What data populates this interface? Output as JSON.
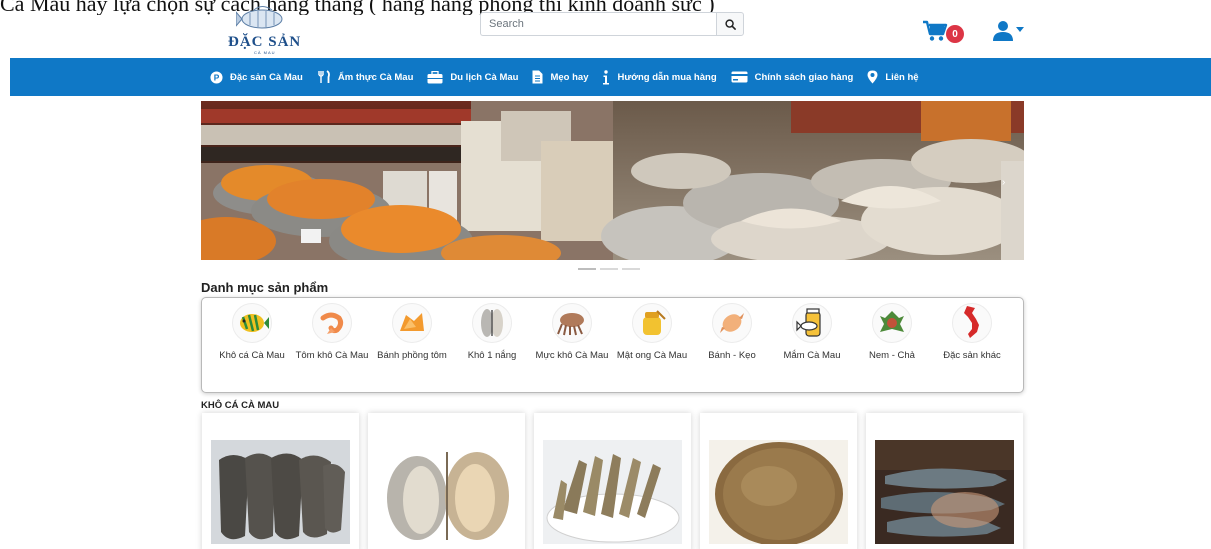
{
  "top_overflow_text": "Cà Mau hãy lựa chọn sự cách hàng thẳng ( hàng hãng phong thì kinh doanh sức )",
  "header": {
    "logo_text": "ĐẶC SẢN",
    "logo_sub": "CÀ MAU",
    "search_placeholder": "Search",
    "cart_count": "0"
  },
  "nav": [
    {
      "label": "Đặc sản Cà Mau",
      "icon": "product-circle-icon"
    },
    {
      "label": "Ẩm thực Cà Mau",
      "icon": "utensils-icon"
    },
    {
      "label": "Du lịch Cà Mau",
      "icon": "suitcase-icon"
    },
    {
      "label": "Mẹo hay",
      "icon": "document-icon"
    },
    {
      "label": "Hướng dẫn mua hàng",
      "icon": "info-icon"
    },
    {
      "label": "Chính sách giao hàng",
      "icon": "credit-card-icon"
    },
    {
      "label": "Liên hệ",
      "icon": "map-marker-icon"
    }
  ],
  "categories_title": "Danh mục sản phẩm",
  "categories": [
    {
      "label": "Khô cá Cà Mau",
      "icon": "fish-icon"
    },
    {
      "label": "Tôm khô Cà Mau",
      "icon": "shrimp-icon"
    },
    {
      "label": "Bánh phồng tôm",
      "icon": "shrimp-cracker-icon"
    },
    {
      "label": "Khô 1 nắng",
      "icon": "dried-fish-icon"
    },
    {
      "label": "Mực khô Cà Mau",
      "icon": "dried-squid-icon"
    },
    {
      "label": "Mật ong Cà Mau",
      "icon": "honey-icon"
    },
    {
      "label": "Bánh - Kẹo",
      "icon": "candy-icon"
    },
    {
      "label": "Mắm Cà Mau",
      "icon": "fish-jar-icon"
    },
    {
      "label": "Nem - Chả",
      "icon": "nem-icon"
    },
    {
      "label": "Đặc sản khác",
      "icon": "vietnam-map-icon"
    }
  ],
  "products_title": "KHÔ CÁ CÀ MAU",
  "colors": {
    "nav_bg": "#0f78c6",
    "brand_blue": "#1e4f8a",
    "badge_red": "#dc3545"
  }
}
